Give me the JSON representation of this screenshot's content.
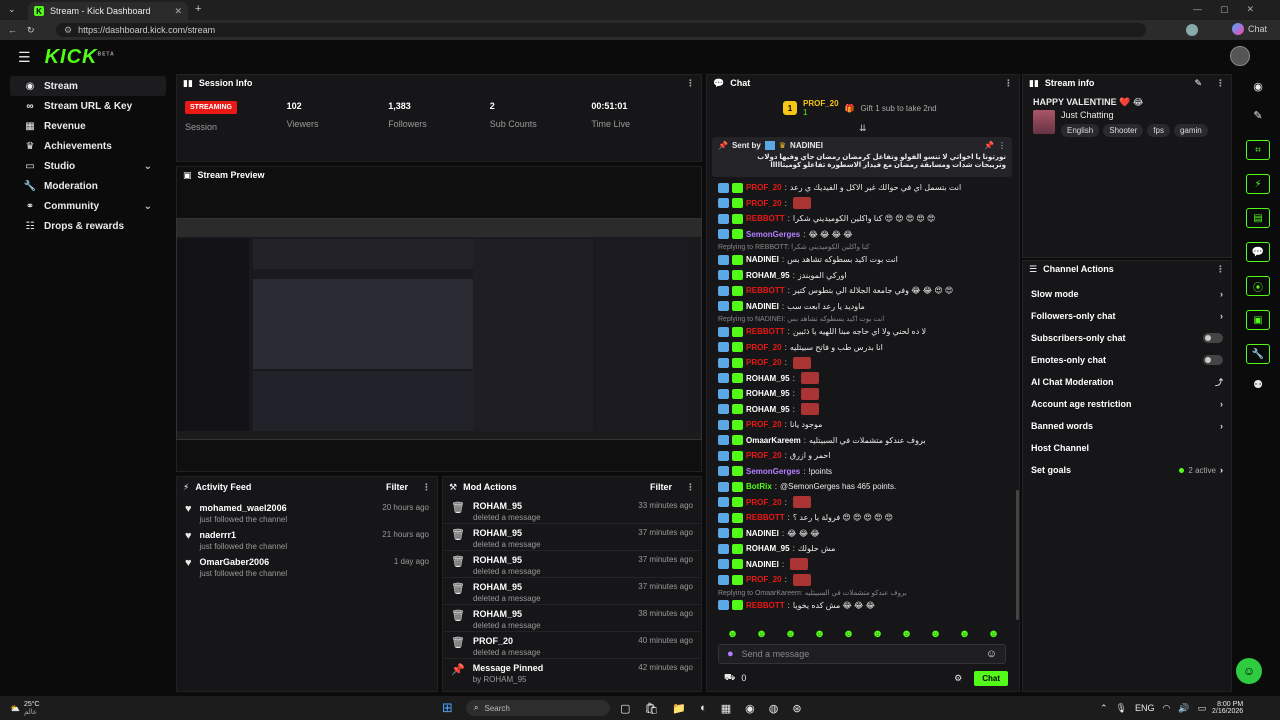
{
  "browser": {
    "tab_title": "Stream - Kick Dashboard",
    "url": "https://dashboard.kick.com/stream",
    "chat_label": "Chat"
  },
  "header": {
    "logo": "KICK",
    "logo_beta": "BETA"
  },
  "sidebar": {
    "items": [
      {
        "label": "Stream",
        "icon": "stream-icon"
      },
      {
        "label": "Stream URL & Key",
        "icon": "link-icon"
      },
      {
        "label": "Revenue",
        "icon": "revenue-icon"
      },
      {
        "label": "Achievements",
        "icon": "trophy-icon"
      },
      {
        "label": "Studio",
        "icon": "studio-icon"
      },
      {
        "label": "Moderation",
        "icon": "wrench-icon"
      },
      {
        "label": "Community",
        "icon": "community-icon"
      },
      {
        "label": "Drops & rewards",
        "icon": "drops-icon"
      }
    ]
  },
  "session": {
    "title": "Session Info",
    "status": "STREAMING",
    "status_label": "Session",
    "stats": [
      {
        "value": "102",
        "label": "Viewers"
      },
      {
        "value": "1,383",
        "label": "Followers"
      },
      {
        "value": "2",
        "label": "Sub Counts"
      },
      {
        "value": "00:51:01",
        "label": "Time Live"
      }
    ]
  },
  "preview": {
    "title": "Stream Preview"
  },
  "activity": {
    "title": "Activity Feed",
    "filter": "Filter",
    "items": [
      {
        "name": "mohamed_wael2006",
        "sub": "just followed the channel",
        "time": "20 hours ago"
      },
      {
        "name": "naderrr1",
        "sub": "just followed the channel",
        "time": "21 hours ago"
      },
      {
        "name": "OmarGaber2006",
        "sub": "just followed the channel",
        "time": "1 day ago"
      }
    ]
  },
  "mod_actions": {
    "title": "Mod Actions",
    "filter": "Filter",
    "items": [
      {
        "name": "ROHAM_95",
        "sub": "deleted a message",
        "time": "33 minutes ago"
      },
      {
        "name": "ROHAM_95",
        "sub": "deleted a message",
        "time": "37 minutes ago"
      },
      {
        "name": "ROHAM_95",
        "sub": "deleted a message",
        "time": "37 minutes ago"
      },
      {
        "name": "ROHAM_95",
        "sub": "deleted a message",
        "time": "37 minutes ago"
      },
      {
        "name": "ROHAM_95",
        "sub": "deleted a message",
        "time": "38 minutes ago"
      },
      {
        "name": "PROF_20",
        "sub": "deleted a message",
        "time": "40 minutes ago"
      },
      {
        "name": "Message Pinned",
        "sub": "by ROHAM_95",
        "time": "42 minutes ago"
      }
    ]
  },
  "chat": {
    "title": "Chat",
    "gifter": "PROF_20",
    "gifter_rank": "1",
    "gifter_count": "1",
    "gift_text": "Gift 1 sub to take 2nd",
    "pinned_by": "Sent by",
    "pinned_user": "NADINEI",
    "pinned_text_1": "نورتونا يا اخواتي لا تنسو الفولو وتفاعل كرمضان رمضان جاي وفيها دولاب",
    "pinned_text_2": "وتريبحات شدات ومسابقة رمضان مع فيدار الاسطورة تفاعلو كوميتااااا",
    "messages": [
      {
        "user": "PROF_20",
        "color": "#e91916",
        "text": "انت بتسمل اي في حوالك غير الاكل و الفيديك ي رعد"
      },
      {
        "user": "PROF_20",
        "color": "#e91916",
        "text": ""
      },
      {
        "user": "REBBOTT",
        "color": "#e91916",
        "text": "كنا واكلين الكوميديني شكرا 😍 😍 😍 😍 😍"
      },
      {
        "user": "SemonGerges",
        "color": "#b480ff",
        "text": "😂 😂 😂 😂"
      },
      {
        "user": "NADINEI",
        "color": "#ffffff",
        "text": "انت بوت اكيد بسطوكه تشاهد بس",
        "reply": "Replying to REBBOTT: كنا واكلين الكوميديني شكرا"
      },
      {
        "user": "ROHAM_95",
        "color": "#ffffff",
        "text": "اوركي الموبندز"
      },
      {
        "user": "REBBOTT",
        "color": "#e91916",
        "text": "وفي جامعة الجلالة الي بتطوس كتير 😂 😂 😍 😍"
      },
      {
        "user": "NADINEI",
        "color": "#ffffff",
        "text": "ماوديد يا رعد ابعت سب"
      },
      {
        "user": "REBBOTT",
        "color": "#e91916",
        "text": "لا ده لحني ولا اي حاجه مبنا اللهيه يا ذئبين",
        "reply": "Replying to NADINEI: انت بوت اكيد بسطوكه تشاهد بس"
      },
      {
        "user": "PROF_20",
        "color": "#e91916",
        "text": "انا بدرس طب و فاتح سبيتليه"
      },
      {
        "user": "PROF_20",
        "color": "#e91916",
        "text": ""
      },
      {
        "user": "ROHAM_95",
        "color": "#ffffff",
        "text": ""
      },
      {
        "user": "ROHAM_95",
        "color": "#ffffff",
        "text": ""
      },
      {
        "user": "ROHAM_95",
        "color": "#ffffff",
        "text": ""
      },
      {
        "user": "PROF_20",
        "color": "#e91916",
        "text": "موجود يانا"
      },
      {
        "user": "OmaarKareem",
        "color": "#ffffff",
        "text": "بروف عندكو متشملات في السبيتليه"
      },
      {
        "user": "PROF_20",
        "color": "#e91916",
        "text": "احمر و ازرق"
      },
      {
        "user": "SemonGerges",
        "color": "#b480ff",
        "text": "!points"
      },
      {
        "user": "BotRix",
        "color": "#53fc18",
        "text": "@SemonGerges has 465 points."
      },
      {
        "user": "PROF_20",
        "color": "#e91916",
        "text": ""
      },
      {
        "user": "REBBOTT",
        "color": "#e91916",
        "text": "فرولة يا رعد ؟ 😍 😍 😍 😍 😍"
      },
      {
        "user": "NADINEI",
        "color": "#ffffff",
        "text": "😂 😂 😂"
      },
      {
        "user": "ROHAM_95",
        "color": "#ffffff",
        "text": "مش حلولك"
      },
      {
        "user": "NADINEI",
        "color": "#ffffff",
        "text": ""
      },
      {
        "user": "PROF_20",
        "color": "#e91916",
        "text": ""
      },
      {
        "user": "REBBOTT",
        "color": "#e91916",
        "text": "مش كده يخويا 😂 😂 😂",
        "reply": "Replying to OmaarKareem: بروف عندكو متشملات في السبيتليه"
      }
    ],
    "placeholder": "Send a message",
    "points": "0",
    "send": "Chat"
  },
  "stream_info": {
    "title": "Stream info",
    "stream_title": "HAPPY VALENTINE ❤️ 😂",
    "category": "Just Chatting",
    "tags": [
      "English",
      "Shooter",
      "fps",
      "gamin"
    ]
  },
  "channel_actions": {
    "title": "Channel Actions",
    "items": [
      {
        "label": "Slow mode",
        "type": "chevron"
      },
      {
        "label": "Followers-only chat",
        "type": "chevron"
      },
      {
        "label": "Subscribers-only chat",
        "type": "toggle"
      },
      {
        "label": "Emotes-only chat",
        "type": "toggle"
      },
      {
        "label": "AI Chat Moderation",
        "type": "chart"
      },
      {
        "label": "Account age restriction",
        "type": "chevron"
      },
      {
        "label": "Banned words",
        "type": "chevron"
      },
      {
        "label": "Host Channel",
        "type": "none"
      },
      {
        "label": "Set goals",
        "type": "goals"
      }
    ],
    "goals_active": "2 active"
  },
  "taskbar": {
    "weather_temp": "25°C",
    "weather_label": "عالم",
    "search": "Search",
    "lang": "ENG",
    "time": "8:00 PM",
    "date": "2/16/2026"
  },
  "colors": {
    "accent": "#53fc18",
    "streaming": "#e91916"
  }
}
